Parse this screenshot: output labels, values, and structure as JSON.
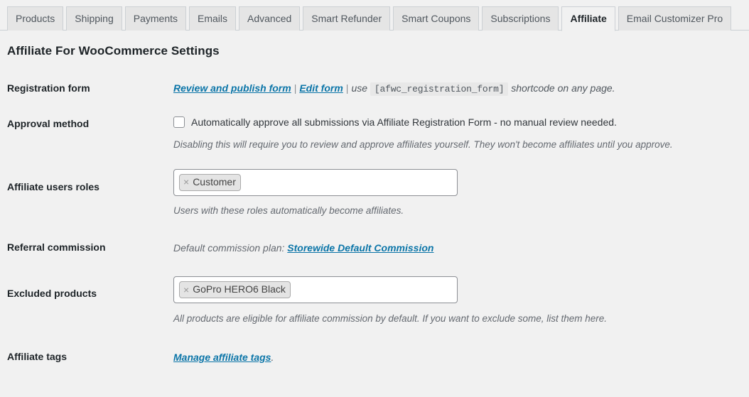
{
  "tabs": [
    {
      "label": "Products",
      "active": false
    },
    {
      "label": "Shipping",
      "active": false
    },
    {
      "label": "Payments",
      "active": false
    },
    {
      "label": "Emails",
      "active": false
    },
    {
      "label": "Advanced",
      "active": false
    },
    {
      "label": "Smart Refunder",
      "active": false
    },
    {
      "label": "Smart Coupons",
      "active": false
    },
    {
      "label": "Subscriptions",
      "active": false
    },
    {
      "label": "Affiliate",
      "active": true
    },
    {
      "label": "Email Customizer Pro",
      "active": false
    }
  ],
  "page": {
    "title": "Affiliate For WooCommerce Settings"
  },
  "rows": {
    "registration": {
      "label": "Registration form",
      "link_review": "Review and publish form",
      "separator": "|",
      "link_edit": "Edit form",
      "separator2": "|",
      "use_word": "use",
      "shortcode": "[afwc_registration_form]",
      "trailing": "shortcode on any page."
    },
    "approval": {
      "label": "Approval method",
      "checkbox_label": "Automatically approve all submissions via Affiliate Registration Form - no manual review needed.",
      "checked": false,
      "description": "Disabling this will require you to review and approve affiliates yourself. They won't become affiliates until you approve."
    },
    "roles": {
      "label": "Affiliate users roles",
      "tokens": [
        "Customer"
      ],
      "remove_glyph": "×",
      "description": "Users with these roles automatically become affiliates."
    },
    "commission": {
      "label": "Referral commission",
      "prefix": "Default commission plan:",
      "link": "Storewide Default Commission"
    },
    "excluded": {
      "label": "Excluded products",
      "tokens": [
        "GoPro HERO6 Black"
      ],
      "remove_glyph": "×",
      "description": "All products are eligible for affiliate commission by default. If you want to exclude some, list them here."
    },
    "tags": {
      "label": "Affiliate tags",
      "link": "Manage affiliate tags",
      "trailing": "."
    }
  },
  "colors": {
    "page_background": "#f1f1f1",
    "link": "#0b75a8",
    "tab_inactive_bg": "#e5e5e5",
    "tab_active_bg": "#f1f1f1",
    "border": "#ccd0d4",
    "token_bg": "#e4e4e4"
  }
}
